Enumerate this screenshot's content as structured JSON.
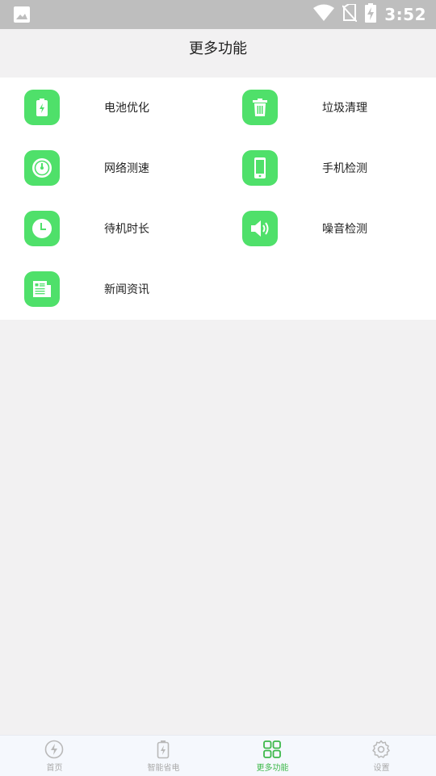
{
  "status_bar": {
    "time": "3:52",
    "icons": [
      "image-icon",
      "wifi-icon",
      "no-sim-icon",
      "battery-charging-icon"
    ]
  },
  "header": {
    "title": "更多功能"
  },
  "features": [
    {
      "label": "电池优化",
      "icon": "battery-icon"
    },
    {
      "label": "垃圾清理",
      "icon": "trash-icon"
    },
    {
      "label": "网络测速",
      "icon": "speedometer-icon"
    },
    {
      "label": "手机检测",
      "icon": "phone-icon"
    },
    {
      "label": "待机时长",
      "icon": "clock-icon"
    },
    {
      "label": "噪音检测",
      "icon": "speaker-icon"
    },
    {
      "label": "新闻资讯",
      "icon": "news-icon"
    }
  ],
  "bottom_nav": {
    "tabs": [
      {
        "label": "首页",
        "icon": "lightning-icon",
        "active": false
      },
      {
        "label": "智能省电",
        "icon": "battery-icon",
        "active": false
      },
      {
        "label": "更多功能",
        "icon": "grid-icon",
        "active": true
      },
      {
        "label": "设置",
        "icon": "gear-icon",
        "active": false
      }
    ]
  },
  "colors": {
    "accent": "#4fe06a",
    "active_tab": "#3db84a",
    "inactive_tab": "#aaaaaa",
    "status_bar": "#bebebe",
    "background": "#f2f1f2"
  }
}
